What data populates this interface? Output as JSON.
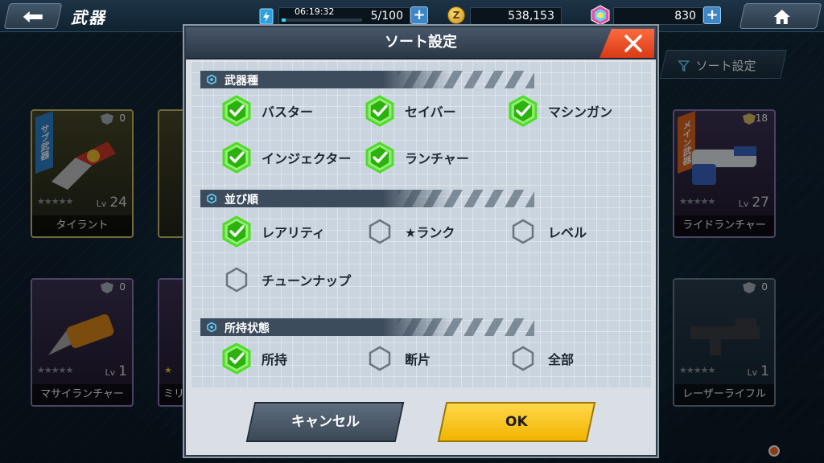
{
  "screen": {
    "title": "武器",
    "timer": "06:19:32",
    "energy": "5/100",
    "energy_fraction": 0.05,
    "coins": "538,153",
    "gems": "830",
    "sort_button_label": "ソート設定"
  },
  "cards": [
    {
      "name": "タイラント",
      "level": "24",
      "count": "0",
      "ribbon": "サブ武器",
      "stars": "★★★★★"
    },
    {
      "name": "ライドランチャー",
      "level": "27",
      "count": "18",
      "ribbon": "メイン武器",
      "stars": "★★★★★"
    },
    {
      "name": "マサイランチャー",
      "level": "1",
      "count": "0",
      "ribbon": "",
      "stars": "★★★★★"
    },
    {
      "name": "ミリ",
      "level": "",
      "count": "",
      "ribbon": "",
      "stars": "★"
    },
    {
      "name": "レーザーライフル",
      "level": "1",
      "count": "0",
      "ribbon": "",
      "stars": "★★★★★"
    }
  ],
  "lv_label": "Lv",
  "modal": {
    "title": "ソート設定",
    "sections": [
      {
        "label": "武器種",
        "options": [
          {
            "label": "バスター",
            "checked": true
          },
          {
            "label": "セイバー",
            "checked": true
          },
          {
            "label": "マシンガン",
            "checked": true
          },
          {
            "label": "インジェクター",
            "checked": true
          },
          {
            "label": "ランチャー",
            "checked": true
          }
        ]
      },
      {
        "label": "並び順",
        "options": [
          {
            "label": "レアリティ",
            "checked": true
          },
          {
            "label": "★ランク",
            "checked": false
          },
          {
            "label": "レベル",
            "checked": false
          },
          {
            "label": "チューンナップ",
            "checked": false
          }
        ]
      },
      {
        "label": "所持状態",
        "options": [
          {
            "label": "所持",
            "checked": true
          },
          {
            "label": "断片",
            "checked": false
          },
          {
            "label": "全部",
            "checked": false
          }
        ]
      }
    ],
    "cancel_label": "キャンセル",
    "ok_label": "OK"
  },
  "colors": {
    "check_green": "#4be01e",
    "ok_yellow": "#f7c51a",
    "close_red": "#e84a20",
    "section_bar": "#3d4c5c"
  }
}
